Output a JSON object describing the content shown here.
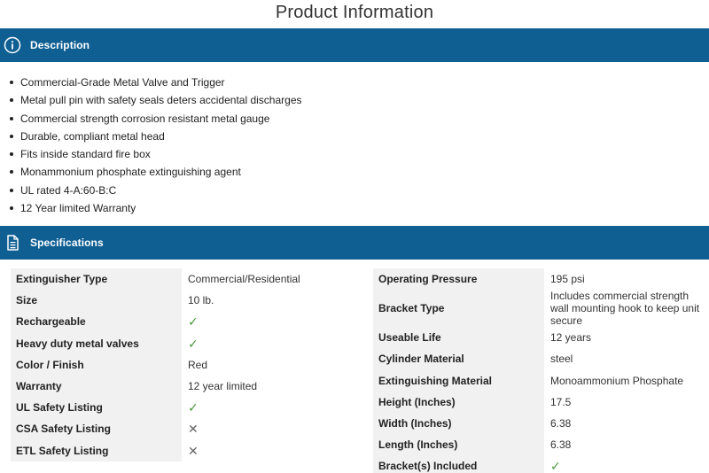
{
  "page": {
    "title": "Product Information"
  },
  "description": {
    "header": "Description",
    "icon": "info-icon",
    "items": [
      "Commercial-Grade Metal Valve and Trigger",
      "Metal pull pin with safety seals deters accidental discharges",
      "Commercial strength corrosion resistant metal gauge",
      "Durable, compliant metal head",
      "Fits inside standard fire box",
      "Monammonium phosphate extinguishing agent",
      "UL rated 4-A:60-B:C",
      "12 Year limited Warranty"
    ]
  },
  "specifications": {
    "header": "Specifications",
    "icon": "document-icon",
    "left": [
      {
        "key": "Extinguisher Type",
        "value": "Commercial/Residential",
        "kind": "text"
      },
      {
        "key": "Size",
        "value": "10 lb.",
        "kind": "text"
      },
      {
        "key": "Rechargeable",
        "value": "✓",
        "kind": "check"
      },
      {
        "key": "Heavy duty metal valves",
        "value": "✓",
        "kind": "check"
      },
      {
        "key": "Color / Finish",
        "value": "Red",
        "kind": "text"
      },
      {
        "key": "Warranty",
        "value": "12 year limited",
        "kind": "text"
      },
      {
        "key": "UL Safety Listing",
        "value": "✓",
        "kind": "check"
      },
      {
        "key": "CSA Safety Listing",
        "value": "✕",
        "kind": "cross"
      },
      {
        "key": "ETL Safety Listing",
        "value": "✕",
        "kind": "cross"
      }
    ],
    "right": [
      {
        "key": "Operating Pressure",
        "value": "195 psi",
        "kind": "text"
      },
      {
        "key": "Bracket Type",
        "value": "Includes commercial strength wall mounting hook to keep unit secure",
        "kind": "text"
      },
      {
        "key": "Useable Life",
        "value": "12 years",
        "kind": "text"
      },
      {
        "key": "Cylinder Material",
        "value": "steel",
        "kind": "text"
      },
      {
        "key": "Extinguishing Material",
        "value": "Monoammonium Phosphate",
        "kind": "text"
      },
      {
        "key": "Height (Inches)",
        "value": "17.5",
        "kind": "text"
      },
      {
        "key": "Width (Inches)",
        "value": "6.38",
        "kind": "text"
      },
      {
        "key": "Length (Inches)",
        "value": "6.38",
        "kind": "text"
      },
      {
        "key": "Bracket(s) Included",
        "value": "✓",
        "kind": "check"
      }
    ]
  },
  "colors": {
    "header_bar": "#0f5f93",
    "check": "#4a9a3a",
    "cross": "#666666",
    "key_bg": "#f1f1f1"
  }
}
